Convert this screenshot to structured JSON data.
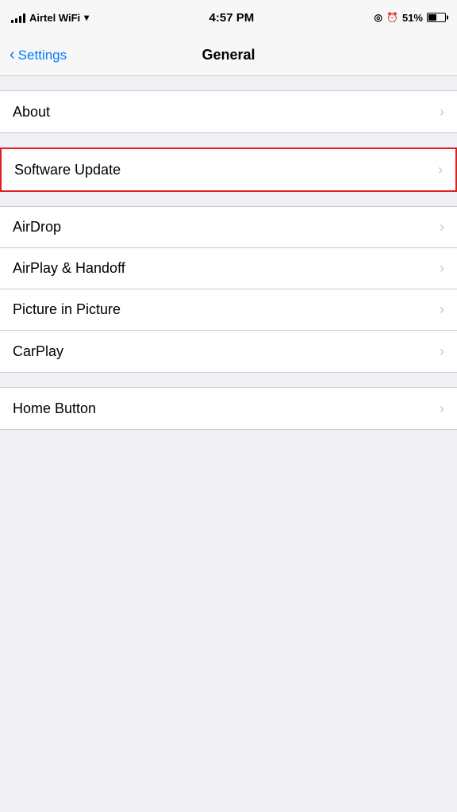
{
  "statusBar": {
    "carrier": "Airtel WiFi",
    "time": "4:57 PM",
    "battery_pct": "51%",
    "alarm_icon": "⏰",
    "location_icon": "◎"
  },
  "navBar": {
    "back_label": "Settings",
    "title": "General"
  },
  "sections": [
    {
      "id": "group1",
      "highlighted": false,
      "items": [
        {
          "id": "about",
          "label": "About"
        }
      ]
    },
    {
      "id": "group2",
      "highlighted": true,
      "items": [
        {
          "id": "software-update",
          "label": "Software Update"
        }
      ]
    },
    {
      "id": "group3",
      "highlighted": false,
      "items": [
        {
          "id": "airdrop",
          "label": "AirDrop"
        },
        {
          "id": "airplay-handoff",
          "label": "AirPlay & Handoff"
        },
        {
          "id": "picture-in-picture",
          "label": "Picture in Picture"
        },
        {
          "id": "carplay",
          "label": "CarPlay"
        }
      ]
    },
    {
      "id": "group4",
      "highlighted": false,
      "items": [
        {
          "id": "home-button",
          "label": "Home Button"
        }
      ]
    }
  ]
}
